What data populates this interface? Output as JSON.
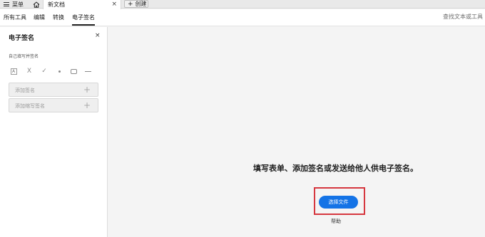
{
  "tabbar": {
    "menu_label": "菜单",
    "doc_tab_label": "新文档",
    "doc_tab_close": "×",
    "create_label": "创建",
    "create_plus": "+"
  },
  "toolbar": {
    "items": [
      "所有工具",
      "编辑",
      "转换",
      "电子签名"
    ],
    "active_index": 3,
    "search_label": "查找文本或工具"
  },
  "panel": {
    "title": "电子签名",
    "close": "×",
    "section_label": "自己填写并签名",
    "tools": {
      "text_box": "A",
      "cross": "X",
      "check": "✓"
    },
    "add_signature": "添加签名",
    "add_initials": "添加缩写签名",
    "plus": "+"
  },
  "main": {
    "headline": "填写表单、添加签名或发送给他人供电子签名。",
    "select_file": "选择文件",
    "help": "帮助"
  },
  "colors": {
    "primary": "#1473e6",
    "highlight": "#d6373f"
  },
  "icons": [
    "hamburger-icon",
    "home-icon",
    "close-icon",
    "plus-icon",
    "text-box-icon",
    "cross-icon",
    "checkmark-icon",
    "dot-icon",
    "rectangle-icon",
    "line-icon"
  ]
}
